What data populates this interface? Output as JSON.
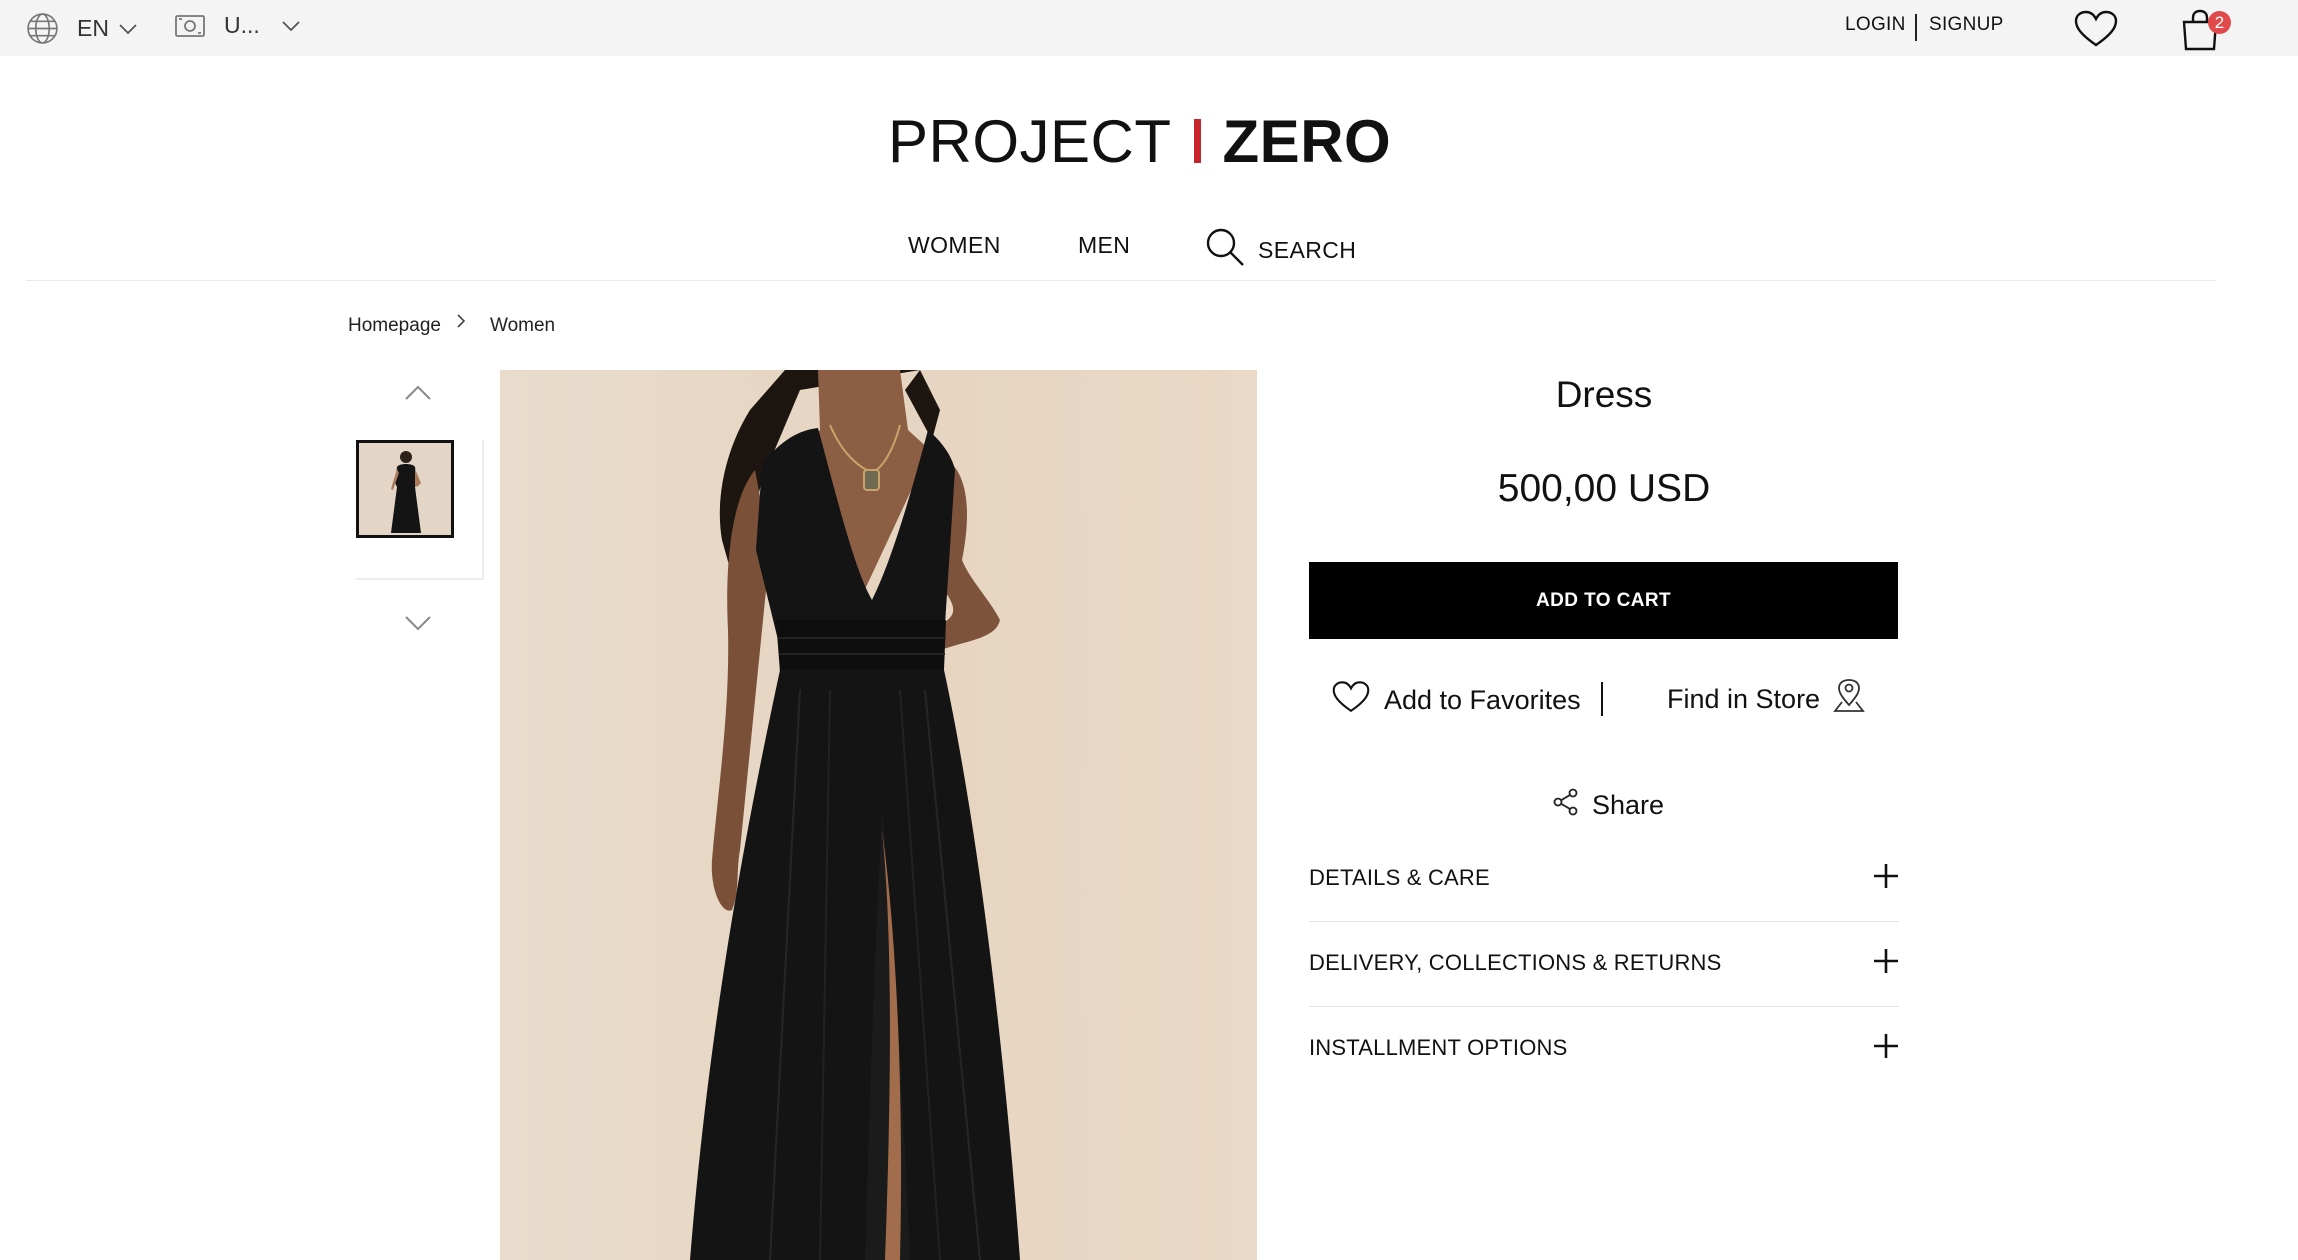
{
  "topbar": {
    "language": "EN",
    "currency": "U...",
    "login": "LOGIN",
    "signup": "SIGNUP",
    "cart_count": "2"
  },
  "brand": {
    "left": "PROJECT",
    "right": "ZERO",
    "accent_color": "#c8262c"
  },
  "nav": {
    "women": "WOMEN",
    "men": "MEN",
    "search": "SEARCH"
  },
  "breadcrumb": {
    "home": "Homepage",
    "current": "Women"
  },
  "product": {
    "title": "Dress",
    "price": "500,00 USD",
    "add_to_cart": "ADD TO CART",
    "add_to_favorites": "Add to Favorites",
    "find_in_store": "Find in Store",
    "share": "Share"
  },
  "accordion": [
    {
      "label": "DETAILS & CARE"
    },
    {
      "label": "DELIVERY, COLLECTIONS & RETURNS"
    },
    {
      "label": "INSTALLMENT OPTIONS"
    }
  ],
  "icons": {
    "globe": "globe-icon",
    "currency": "banknote-icon",
    "heart": "heart-icon",
    "bag": "shopping-bag-icon",
    "search": "search-icon",
    "location": "location-pin-icon",
    "share": "share-icon",
    "plus": "plus-icon"
  },
  "colors": {
    "badge": "#e14a4a",
    "button": "#000000",
    "topbar_bg": "#f4f4f4"
  }
}
